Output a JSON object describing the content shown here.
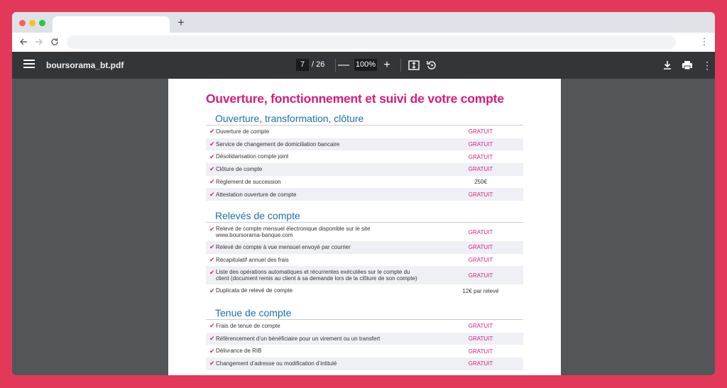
{
  "browser": {
    "new_tab_symbol": "+",
    "menu_symbol": "⋮"
  },
  "viewer": {
    "filename": "boursorama_bt.pdf",
    "current_page": "7",
    "total_pages": "/ 26",
    "zoom": "100%",
    "zoom_out": "—",
    "zoom_in": "+"
  },
  "document": {
    "title": "Ouverture, fonctionnement et suivi de votre compte",
    "sections": [
      {
        "heading": "Ouverture, transformation, clôture",
        "rows": [
          {
            "label": "Ouverture de compte",
            "price": "GRATUIT"
          },
          {
            "label": "Service de changement de domiciliation bancaire",
            "price": "GRATUIT"
          },
          {
            "label": "Désolidarisation compte joint",
            "price": "GRATUIT"
          },
          {
            "label": "Clôture de compte",
            "price": "GRATUIT"
          },
          {
            "label": "Règlement de succession",
            "price": "250€"
          },
          {
            "label": "Attestation ouverture de compte",
            "price": "GRATUIT"
          }
        ]
      },
      {
        "heading": "Relevés de compte",
        "rows": [
          {
            "label": "Relevé de compte mensuel électronique disponible sur le site",
            "label2": "www.boursorama-banque.com",
            "price": "GRATUIT"
          },
          {
            "label": "Relevé de compte à vue mensuel envoyé par courrier",
            "price": "GRATUIT"
          },
          {
            "label": "Récapitulatif annuel des frais",
            "price": "GRATUIT"
          },
          {
            "label": "Liste des opérations automatiques et récurrentes exécutées  sur le compte du",
            "label2": "client (document remis au client à sa demande lors de la clôture de son compte)",
            "price": "GRATUIT"
          },
          {
            "label": "Duplicata de relevé de compte",
            "price": "12€ par relevé"
          }
        ]
      },
      {
        "heading": "Tenue de compte",
        "rows": [
          {
            "label": "Frais de tenue de compte",
            "price": "GRATUIT"
          },
          {
            "label": "Référencement d’un bénéficiaire pour un virement ou un transfert",
            "price": "GRATUIT"
          },
          {
            "label": "Délivrance de RIB",
            "price": "GRATUIT"
          },
          {
            "label": "Changement d’adresse ou modification d’intitulé",
            "price": "GRATUIT"
          }
        ]
      }
    ]
  },
  "colors": {
    "frame": "#e2395a",
    "accent_pink": "#d81b7e",
    "heading_blue": "#1d6fa8",
    "toolbar": "#323639",
    "viewer_bg": "#525659"
  }
}
